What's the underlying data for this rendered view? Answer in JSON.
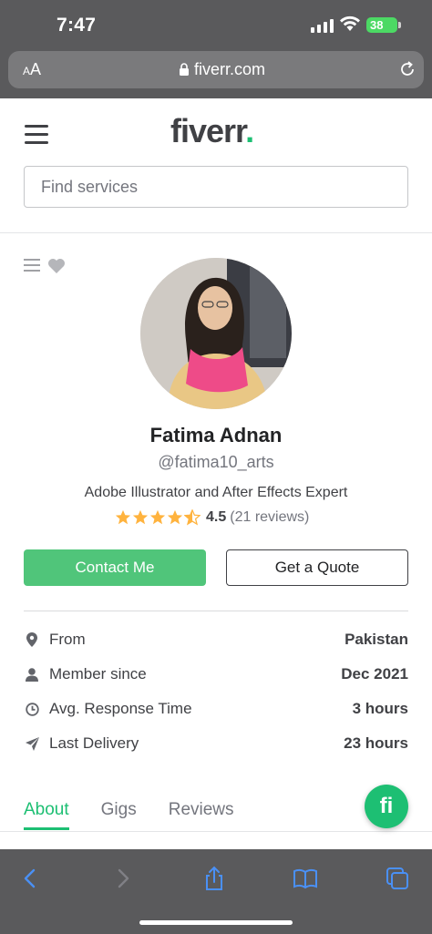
{
  "status_bar": {
    "time": "7:47",
    "battery": "38"
  },
  "browser": {
    "text_size_label_small": "A",
    "text_size_label_large": "A",
    "url": "fiverr.com"
  },
  "header": {
    "logo_text": "fiverr",
    "logo_dot": ".",
    "search_placeholder": "Find services"
  },
  "profile": {
    "name": "Fatima Adnan",
    "handle": "@fatima10_arts",
    "tagline": "Adobe Illustrator and After Effects Expert",
    "rating": "4.5",
    "rating_value": 4.5,
    "rating_max": 5,
    "reviews": "(21 reviews)"
  },
  "actions": {
    "contact_label": "Contact Me",
    "quote_label": "Get a Quote"
  },
  "stats": [
    {
      "label": "From",
      "value": "Pakistan",
      "icon": "location-pin-icon"
    },
    {
      "label": "Member since",
      "value": "Dec 2021",
      "icon": "user-icon"
    },
    {
      "label": "Avg. Response Time",
      "value": "3 hours",
      "icon": "clock-icon"
    },
    {
      "label": "Last Delivery",
      "value": "23 hours",
      "icon": "paper-plane-icon"
    }
  ],
  "tabs": [
    {
      "label": "About",
      "active": true
    },
    {
      "label": "Gigs",
      "active": false
    },
    {
      "label": "Reviews",
      "active": false
    }
  ],
  "chat_button": {
    "label": "fi"
  },
  "colors": {
    "brand_green": "#1dbf73",
    "button_green": "#50c57a",
    "star": "#ffb33e",
    "chrome": "#5a5a5c",
    "ios_blue": "#4a90f5"
  }
}
